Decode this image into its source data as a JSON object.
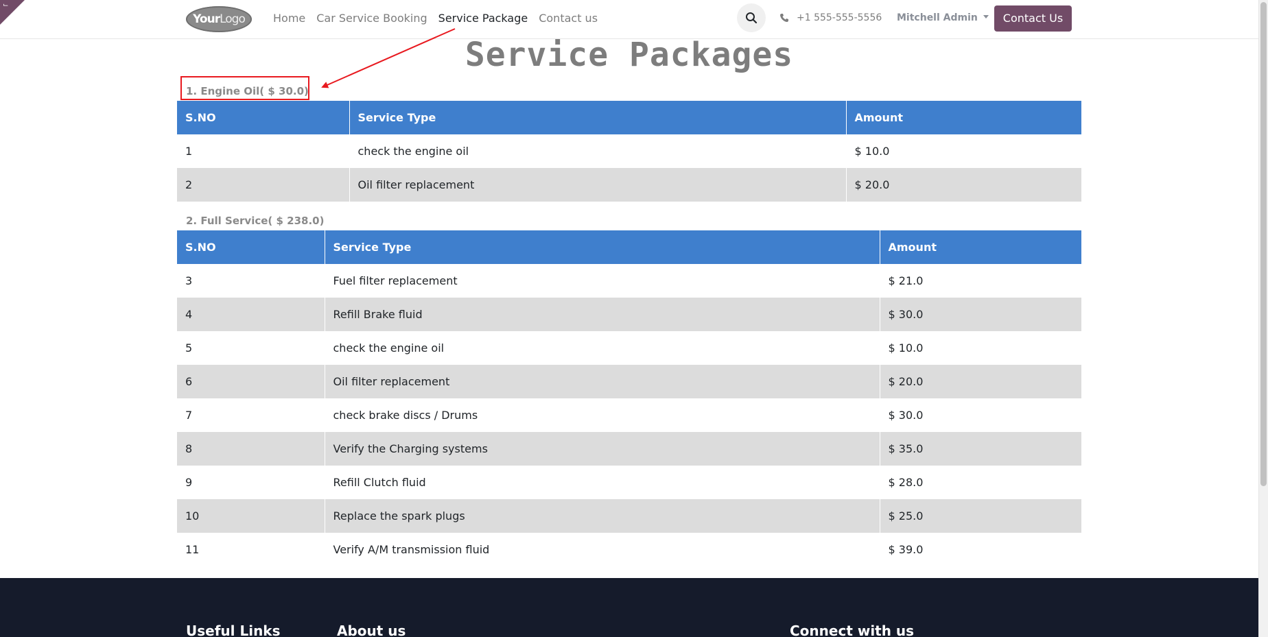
{
  "header": {
    "logo": {
      "text_bold": "Your",
      "text_light": "Logo"
    },
    "nav": [
      {
        "label": "Home",
        "active": false
      },
      {
        "label": "Car Service Booking",
        "active": false
      },
      {
        "label": "Service Package",
        "active": true
      },
      {
        "label": "Contact us",
        "active": false
      }
    ],
    "search_icon": "search-icon",
    "phone": {
      "icon": "phone-icon",
      "text": "+1 555-555-5556"
    },
    "user": {
      "label": "Mitchell Admin"
    },
    "contact_button": {
      "label": "Contact Us",
      "color": "#714B67"
    }
  },
  "main": {
    "title": "Service Packages",
    "columns": [
      "S.NO",
      "Service Type",
      "Amount"
    ],
    "header_color": "#3f7fcd",
    "packages": [
      {
        "title": "1. Engine Oil( $ 30.0)",
        "rows": [
          {
            "sno": "1",
            "service": "check the engine oil",
            "amount": "$ 10.0"
          },
          {
            "sno": "2",
            "service": "Oil filter replacement",
            "amount": "$ 20.0"
          }
        ]
      },
      {
        "title": "2. Full Service( $ 238.0)",
        "rows": [
          {
            "sno": "3",
            "service": "Fuel filter replacement",
            "amount": "$ 21.0"
          },
          {
            "sno": "4",
            "service": "Refill Brake fluid",
            "amount": "$ 30.0"
          },
          {
            "sno": "5",
            "service": "check the engine oil",
            "amount": "$ 10.0"
          },
          {
            "sno": "6",
            "service": "Oil filter replacement",
            "amount": "$ 20.0"
          },
          {
            "sno": "7",
            "service": "check brake discs / Drums",
            "amount": "$ 30.0"
          },
          {
            "sno": "8",
            "service": "Verify the Charging systems",
            "amount": "$ 35.0"
          },
          {
            "sno": "9",
            "service": "Refill Clutch fluid",
            "amount": "$ 28.0"
          },
          {
            "sno": "10",
            "service": "Replace the spark plugs",
            "amount": "$ 25.0"
          },
          {
            "sno": "11",
            "service": "Verify A/M transmission fluid",
            "amount": "$ 39.0"
          }
        ]
      }
    ]
  },
  "footer": {
    "headings": [
      "Useful Links",
      "About us",
      "Connect with us"
    ],
    "background": "#151b2b"
  },
  "annotation": {
    "color": "#e8191f"
  }
}
